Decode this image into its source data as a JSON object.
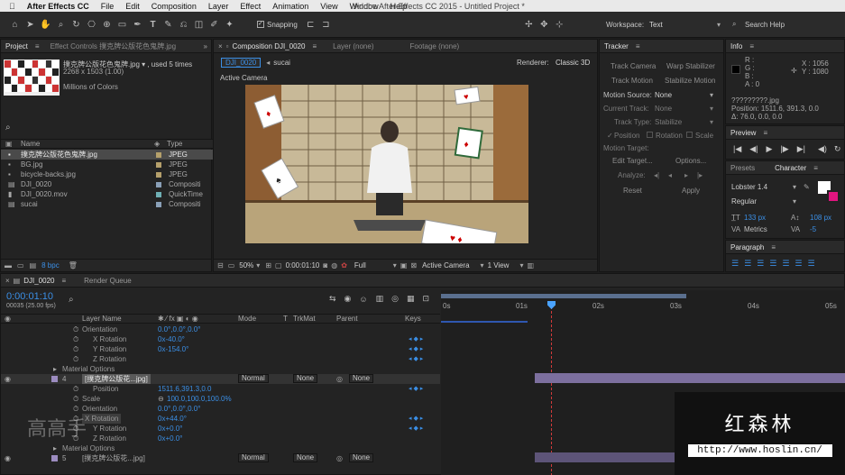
{
  "menubar": {
    "apple": "",
    "app": "After Effects CC",
    "items": [
      "File",
      "Edit",
      "Composition",
      "Layer",
      "Effect",
      "Animation",
      "View",
      "Window",
      "Help"
    ],
    "window_title": "Adobe After Effects CC 2015 - Untitled Project *"
  },
  "toolbar": {
    "snapping": "Snapping",
    "workspace_label": "Workspace:",
    "workspace_value": "Text",
    "search_help": "Search Help"
  },
  "project": {
    "tab": "Project",
    "effect_controls_tab": "Effect Controls 撲克牌公版花色鬼牌.jpg",
    "selected_name": "撲克牌公版花色鬼牌.jpg ▾ , used 5 times",
    "dimensions": "2268 x 1503 (1.00)",
    "color": "Millions of Colors",
    "col_name": "Name",
    "col_type": "Type",
    "items": [
      {
        "name": "撲克牌公版花色鬼牌.jpg",
        "type": "JPEG"
      },
      {
        "name": "BG.jpg",
        "type": "JPEG"
      },
      {
        "name": "bicycle-backs.jpg",
        "type": "JPEG"
      },
      {
        "name": "DJI_0020",
        "type": "Compositi"
      },
      {
        "name": "DJI_0020.mov",
        "type": "QuickTime"
      },
      {
        "name": "sucai",
        "type": "Compositi"
      }
    ],
    "bpc": "8 bpc"
  },
  "composition": {
    "tab": "Composition DJI_0020",
    "layer_tab": "Layer (none)",
    "footage_tab": "Footage (none)",
    "crumb1": "DJI_0020",
    "crumb2": "sucai",
    "renderer_label": "Renderer:",
    "renderer_value": "Classic 3D",
    "active_camera": "Active Camera",
    "zoom": "50%",
    "timecode": "0:00:01:10",
    "resolution": "Full",
    "camera": "Active Camera",
    "view": "1 View"
  },
  "tracker": {
    "title": "Tracker",
    "track_camera": "Track Camera",
    "warp_stabilizer": "Warp Stabilizer",
    "track_motion": "Track Motion",
    "stabilize_motion": "Stabilize Motion",
    "motion_source_label": "Motion Source:",
    "motion_source_value": "None",
    "current_track_label": "Current Track:",
    "current_track_value": "None",
    "track_type_label": "Track Type:",
    "track_type_value": "Stabilize",
    "position": "Position",
    "rotation": "Rotation",
    "scale": "Scale",
    "motion_target": "Motion Target:",
    "edit_target": "Edit Target...",
    "options": "Options...",
    "analyze": "Analyze:",
    "reset": "Reset",
    "apply": "Apply"
  },
  "info": {
    "title": "Info",
    "r": "R :",
    "g": "G :",
    "b": "B :",
    "a": "A : 0",
    "x": "X : 1056",
    "y": "Y : 1080",
    "file": "?????????.jpg",
    "position": "Position: 1511.6, 391.3, 0.0",
    "delta": "Δ: 76.0, 0.0, 0.0"
  },
  "preview": {
    "title": "Preview"
  },
  "character": {
    "presets_tab": "Presets",
    "title": "Character",
    "font": "Lobster 1.4",
    "style": "Regular",
    "size": "133 px",
    "leading": "108 px",
    "kerning": "Metrics",
    "tracking": "-5"
  },
  "paragraph": {
    "title": "Paragraph"
  },
  "timeline": {
    "comp_tab": "DJI_0020",
    "render_queue": "Render Queue",
    "timecode": "0:00:01:10",
    "frames": "00035 (25.00 fps)",
    "col_layer": "Layer Name",
    "col_mode": "Mode",
    "col_t": "T",
    "col_trkmat": "TrkMat",
    "col_parent": "Parent",
    "col_keys": "Keys",
    "ruler": [
      "0s",
      "01s",
      "02s",
      "03s",
      "04s",
      "05s"
    ],
    "rows": [
      {
        "label": "Orientation",
        "value": "0.0°,0.0°,0.0°"
      },
      {
        "label": "X Rotation",
        "value": "0x-40.0°"
      },
      {
        "label": "Y Rotation",
        "value": "0x-154.0°"
      },
      {
        "label": "Z Rotation",
        "value": "0x+0.0°"
      },
      {
        "label": "Material Options",
        "value": ""
      },
      {
        "label": "Position",
        "value": "1511.6,391.3,0.0"
      },
      {
        "label": "Scale",
        "value": "100.0,100.0,100.0%"
      },
      {
        "label": "Orientation",
        "value": "0.0°,0.0°,0.0°"
      },
      {
        "label": "X Rotation",
        "value": "0x+44.0°"
      },
      {
        "label": "Y Rotation",
        "value": "0x+0.0°"
      },
      {
        "label": "Z Rotation",
        "value": "0x+0.0°"
      },
      {
        "label": "Material Options",
        "value": ""
      }
    ],
    "layer4": {
      "num": "4",
      "name": "[撲克牌公版花...jpg]",
      "mode": "Normal",
      "trkmat": "None",
      "parent": "None"
    },
    "layer5": {
      "num": "5",
      "name": "[撲克牌公版花...jpg]",
      "mode": "Normal",
      "trkmat": "None",
      "parent": "None"
    }
  },
  "watermark": {
    "brand": "红森林",
    "url": "http://www.hoslin.cn/",
    "left_logo": "高高手"
  }
}
